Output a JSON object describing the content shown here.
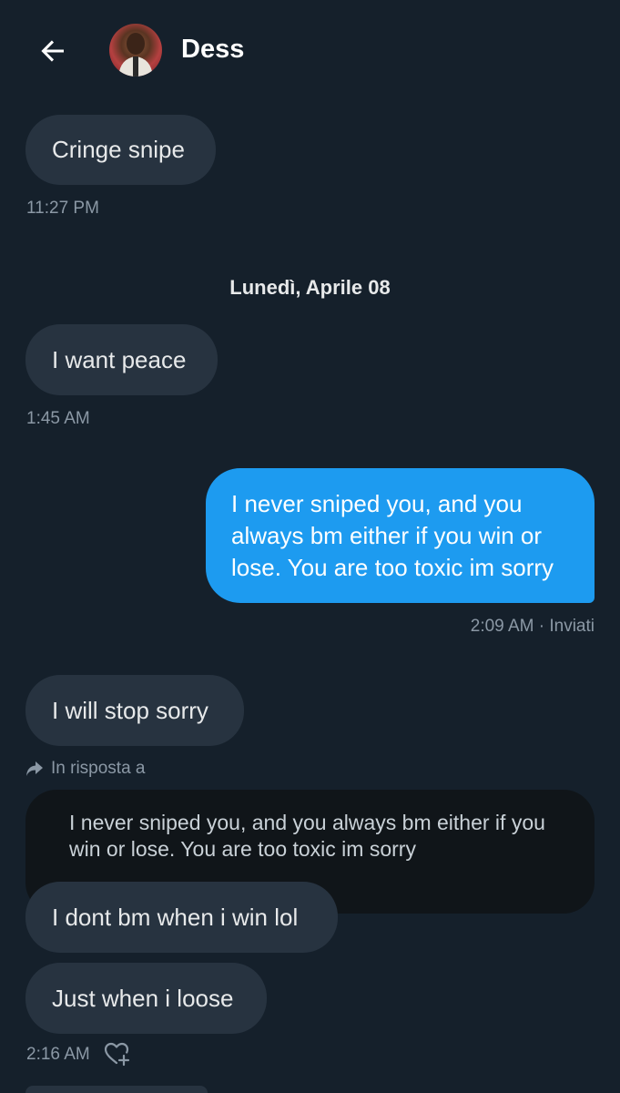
{
  "header": {
    "contact_name": "Dess",
    "back_icon": "arrow-left-icon"
  },
  "messages": [
    {
      "text": "Cringe snipe",
      "time": "11:27 PM",
      "direction": "in"
    },
    {
      "date_separator": "Lunedì, Aprile 08"
    },
    {
      "text": "I want peace",
      "time": "1:45 AM",
      "direction": "in"
    },
    {
      "text_lines": [
        "I never sniped you, and you",
        "always bm either if you win or",
        "lose. You are too toxic im sorry"
      ],
      "time": "2:09 AM · Inviati",
      "direction": "out"
    },
    {
      "text": "I will stop sorry",
      "direction": "in"
    },
    {
      "reply_label": "In risposta a",
      "quoted_text": "I never sniped you, and you always bm either if you win or lose. You are too toxic im sorry"
    },
    {
      "text": "I dont bm when i win lol",
      "direction": "in"
    },
    {
      "text": "Just when i loose",
      "time": "2:16 AM",
      "direction": "in",
      "reaction_icon": "heart-plus-icon"
    }
  ],
  "colors": {
    "background": "#15202b",
    "incoming_bubble": "#273340",
    "outgoing_bubble": "#1d9bf0",
    "quoted_bubble": "#101519",
    "meta_text": "#8b98a5"
  }
}
